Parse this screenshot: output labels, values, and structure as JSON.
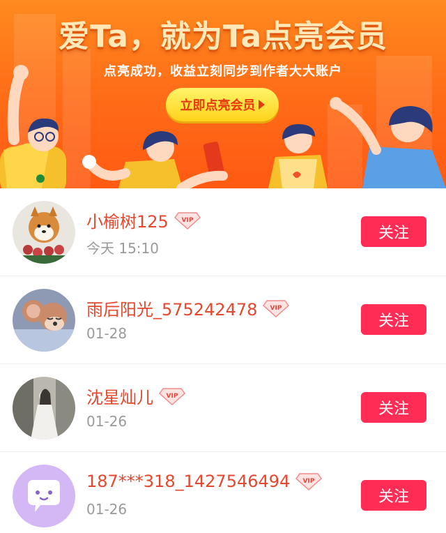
{
  "banner": {
    "title": "爱Ta，就为Ta点亮会员",
    "subtitle": "点亮成功，收益立刻同步到作者大大账户",
    "button_label": "立即点亮会员",
    "colors": {
      "background": "#ff6a17",
      "title": "#ffe9b8",
      "button": "#ffd21a",
      "button_text": "#e5390e"
    }
  },
  "followers": [
    {
      "name": "小榆树125",
      "time": "今天 15:10",
      "avatar": "shiba-dog-with-roses",
      "vip_icon": "vip-diamond-icon",
      "follow_label": "关注"
    },
    {
      "name": "雨后阳光_575242478",
      "time": "01-28",
      "avatar": "cartoon-mouse-sleeping",
      "vip_icon": "vip-diamond-icon",
      "follow_label": "关注"
    },
    {
      "name": "沈星灿儿",
      "time": "01-26",
      "avatar": "girl-in-white-dress",
      "vip_icon": "vip-diamond-icon",
      "follow_label": "关注"
    },
    {
      "name": "187***318_1427546494",
      "time": "01-26",
      "avatar": "chat-bubble-default-avatar",
      "vip_icon": "vip-diamond-icon",
      "follow_label": "关注"
    }
  ],
  "colors": {
    "name": "#e4482f",
    "time": "#9a9a9a",
    "follow_button": "#ff2d55"
  }
}
